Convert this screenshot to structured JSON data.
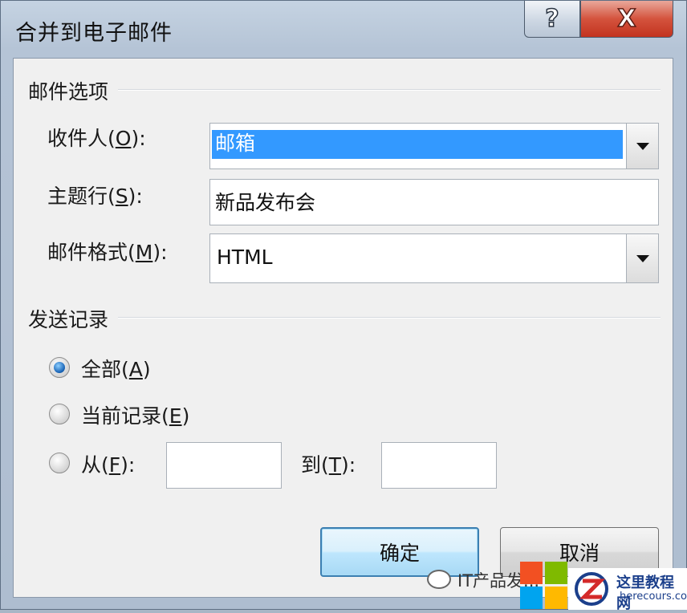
{
  "window": {
    "title": "合并到电子邮件",
    "help_glyph": "?",
    "close_glyph": "X"
  },
  "mail_options": {
    "heading": "邮件选项",
    "recipient": {
      "label_pre": "收件人(",
      "accel": "O",
      "label_post": "):",
      "value": "邮箱"
    },
    "subject": {
      "label_pre": "主题行(",
      "accel": "S",
      "label_post": "):",
      "value": "新品发布会"
    },
    "format": {
      "label_pre": "邮件格式(",
      "accel": "M",
      "label_post": "):",
      "value": "HTML"
    }
  },
  "send_records": {
    "heading": "发送记录",
    "all": {
      "label_pre": "全部(",
      "accel": "A",
      "label_post": ")",
      "checked": true
    },
    "current": {
      "label_pre": "当前记录(",
      "accel": "E",
      "label_post": ")",
      "checked": false
    },
    "range": {
      "from_pre": "从(",
      "from_accel": "F",
      "from_post": "):",
      "from_value": "",
      "to_pre": "到(",
      "to_accel": "T",
      "to_post": "):",
      "to_value": "",
      "checked": false
    }
  },
  "buttons": {
    "ok": "确定",
    "cancel": "取消"
  },
  "watermark": {
    "text": "IT产品发...",
    "site_cn": "这里教程网",
    "site_en": "herecours.com"
  },
  "colors": {
    "selection": "#3399ff",
    "close_button": "#c8412c",
    "title_bar": "#b9c8da"
  }
}
